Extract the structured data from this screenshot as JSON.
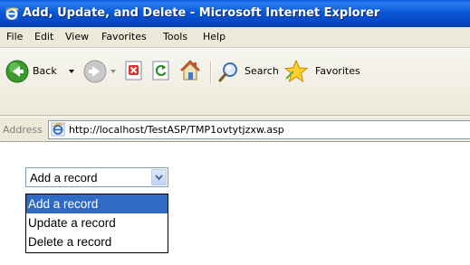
{
  "window": {
    "title": "Add, Update, and Delete - Microsoft Internet Explorer",
    "title_icon": "ie-logo-icon"
  },
  "menubar": {
    "items": [
      "File",
      "Edit",
      "View",
      "Favorites",
      "Tools",
      "Help"
    ]
  },
  "toolbar": {
    "back_label": "Back",
    "search_label": "Search",
    "favorites_label": "Favorites",
    "icons": [
      "back-icon",
      "forward-icon",
      "stop-icon",
      "refresh-icon",
      "home-icon",
      "search-icon",
      "favorites-star-icon"
    ]
  },
  "address": {
    "label": "Address",
    "url": "http://localhost/TestASP/TMP1ovtytjzxw.asp"
  },
  "form": {
    "select_value": "Add a record",
    "options": [
      "Add a record",
      "Update a record",
      "Delete a record"
    ],
    "highlighted_option": "Add a record"
  },
  "colors": {
    "titlebar": "#0a58d6",
    "chrome": "#ece9d8",
    "selection": "#316ac5"
  }
}
